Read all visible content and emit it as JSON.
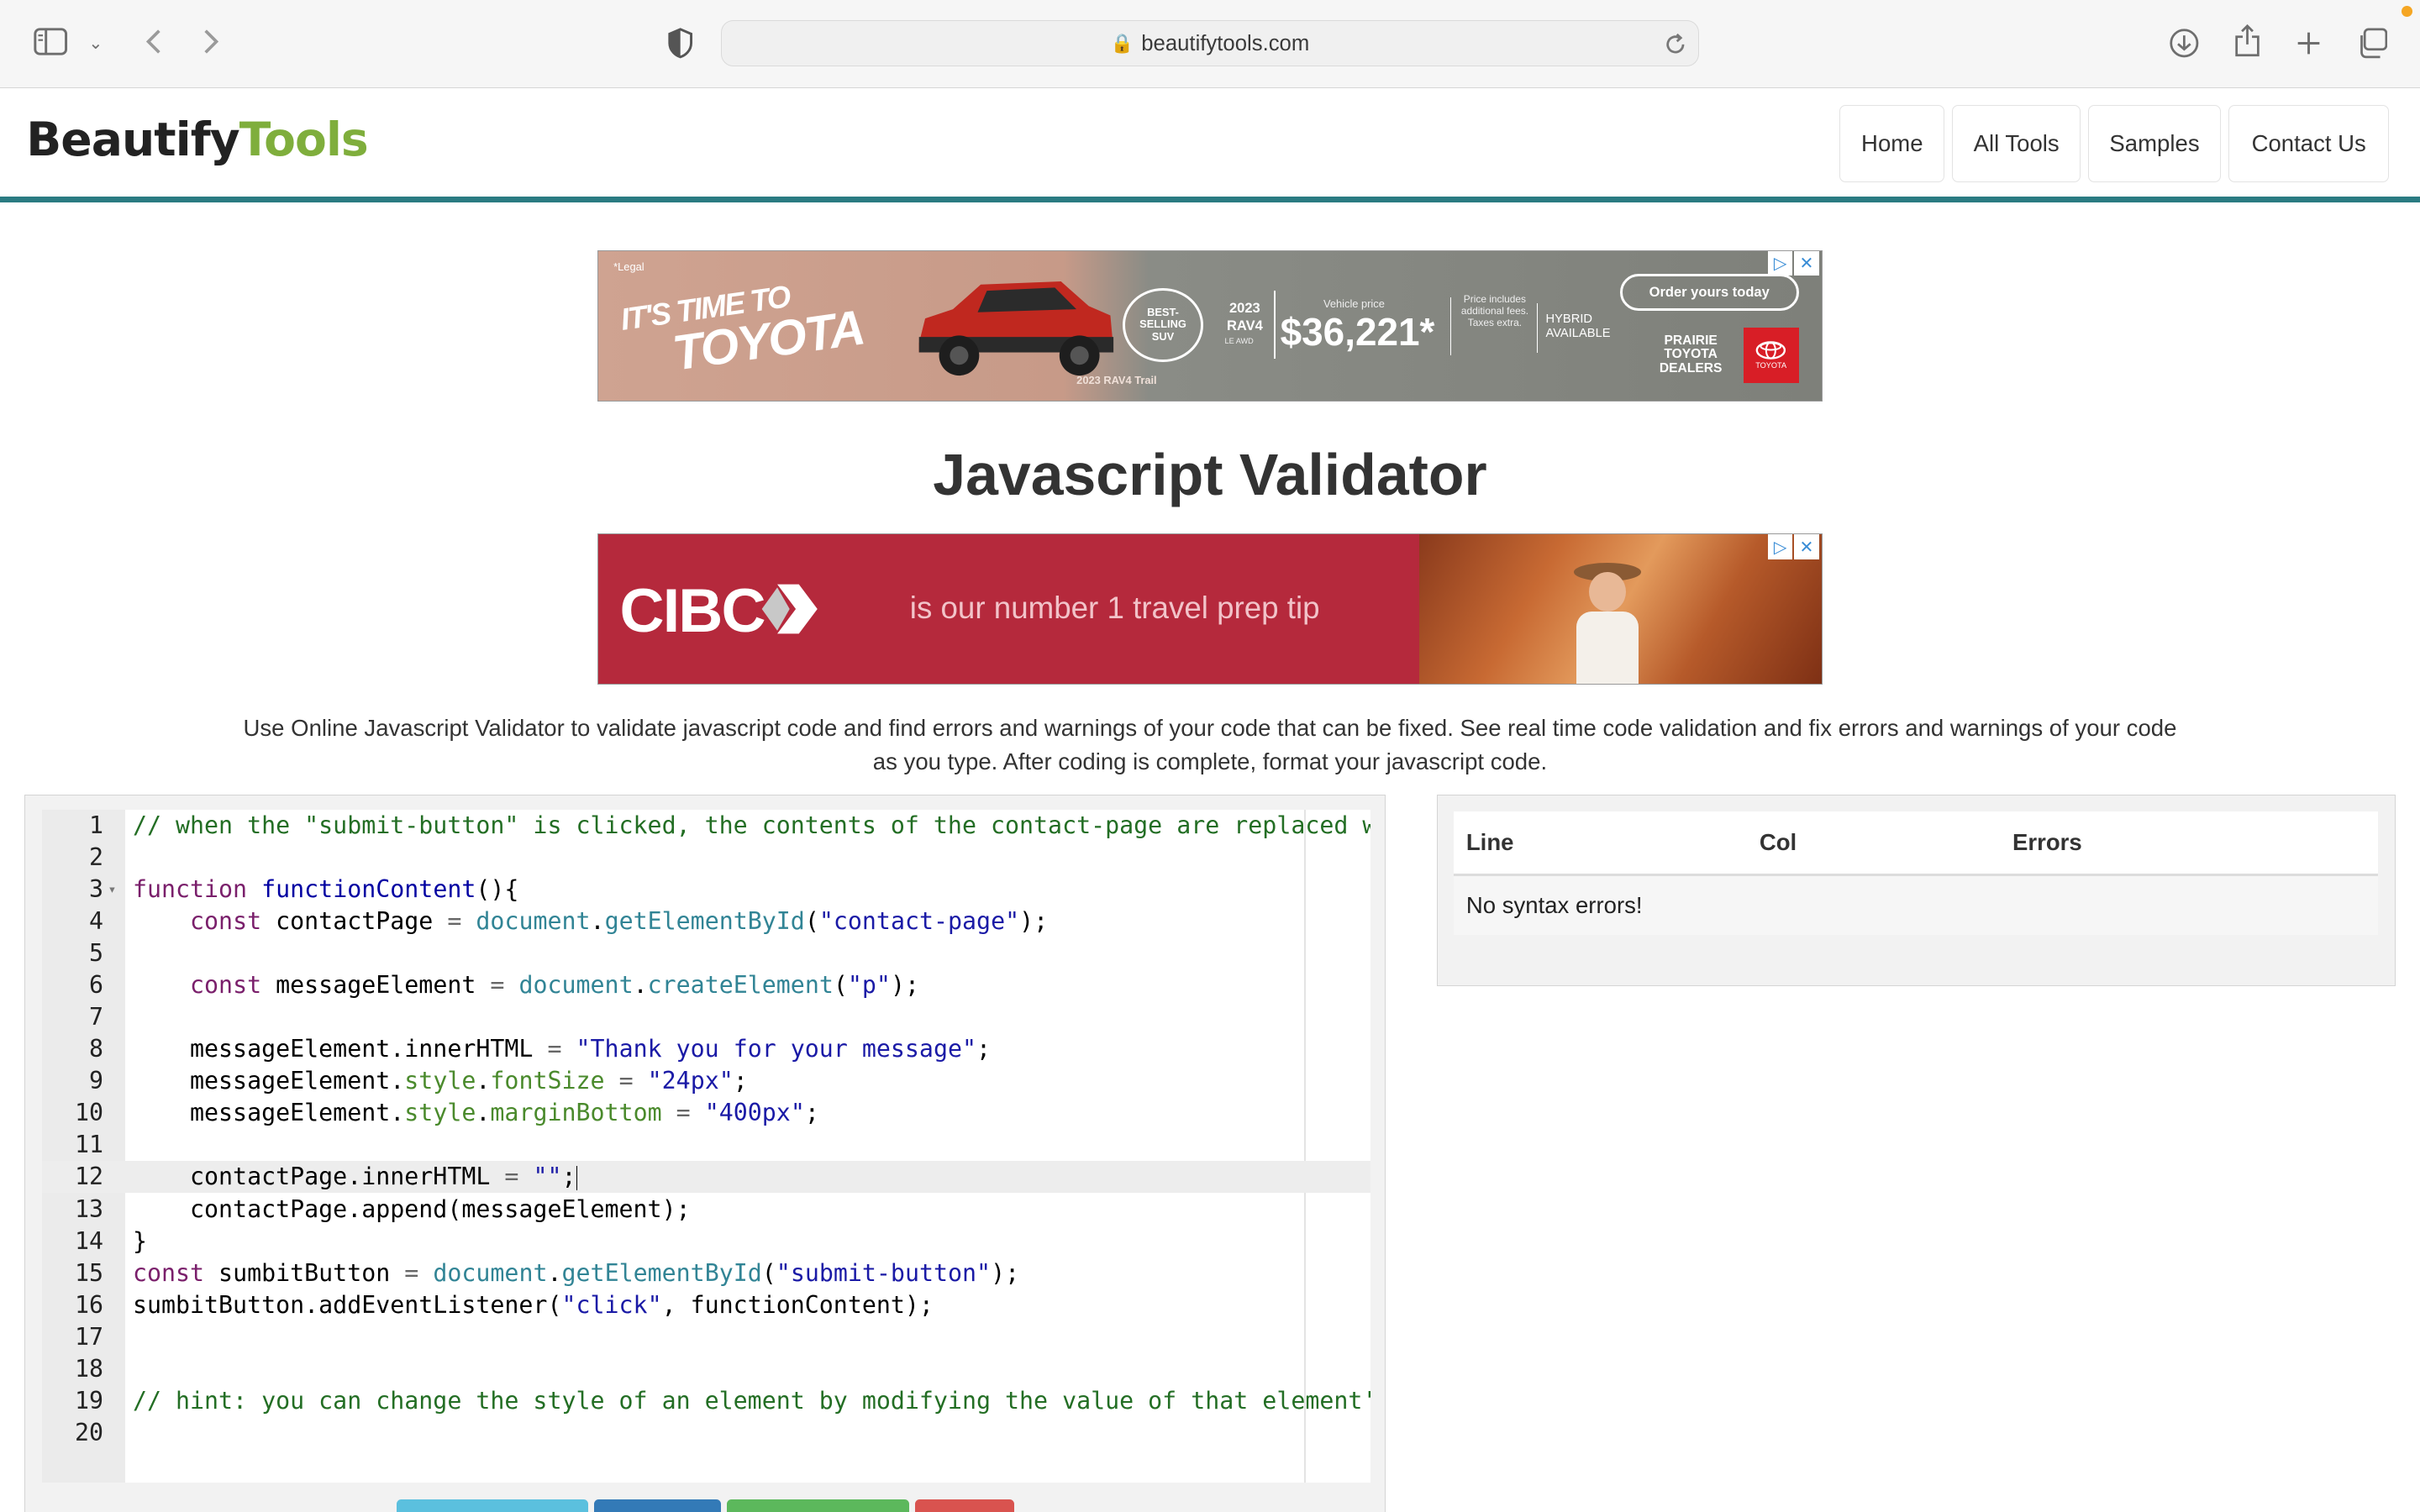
{
  "browser": {
    "url": "beautifytools.com"
  },
  "site": {
    "logo_part1": "Beautify",
    "logo_part2": "Tools",
    "nav": [
      "Home",
      "All Tools",
      "Samples",
      "Contact Us"
    ]
  },
  "ads": {
    "toyota": {
      "legal": "*Legal",
      "headline1": "IT'S TIME TO",
      "headline2": "TOYOTA",
      "model_caption": "2023 RAV4 Trail",
      "award": "BEST-SELLING SUV",
      "year_model": "2023 RAV4",
      "trim": "LE AWD",
      "vehicle_price_label": "Vehicle price",
      "price": "$36,221*",
      "price_note": "Price includes additional fees. Taxes extra.",
      "hybrid": "HYBRID AVAILABLE",
      "cta": "Order yours today",
      "dealer": "PRAIRIE TOYOTA DEALERS",
      "brand": "TOYOTA"
    },
    "cibc": {
      "brand": "CIBC",
      "tagline": "is our number 1 travel prep tip"
    }
  },
  "page": {
    "title": "Javascript Validator",
    "description": "Use Online Javascript Validator to validate javascript code and find errors and warnings of your code that can be fixed. See real time code validation and fix errors and warnings of your code as you type. After coding is complete, format your javascript code."
  },
  "editor": {
    "active_line": 12,
    "lines": [
      {
        "n": "1",
        "code": "// when the \"submit-button\" is clicked, the contents of the contact-page are replaced wi"
      },
      {
        "n": "2",
        "code": ""
      },
      {
        "n": "3",
        "code": "function functionContent(){"
      },
      {
        "n": "4",
        "code": "    const contactPage = document.getElementById(\"contact-page\");"
      },
      {
        "n": "5",
        "code": ""
      },
      {
        "n": "6",
        "code": "    const messageElement = document.createElement(\"p\");"
      },
      {
        "n": "7",
        "code": ""
      },
      {
        "n": "8",
        "code": "    messageElement.innerHTML = \"Thank you for your message\";"
      },
      {
        "n": "9",
        "code": "    messageElement.style.fontSize = \"24px\";"
      },
      {
        "n": "10",
        "code": "    messageElement.style.marginBottom = \"400px\";"
      },
      {
        "n": "11",
        "code": ""
      },
      {
        "n": "12",
        "code": "    contactPage.innerHTML = \"\";"
      },
      {
        "n": "13",
        "code": "    contactPage.append(messageElement);"
      },
      {
        "n": "14",
        "code": "}"
      },
      {
        "n": "15",
        "code": "const sumbitButton = document.getElementById(\"submit-button\");"
      },
      {
        "n": "16",
        "code": "sumbitButton.addEventListener(\"click\", functionContent);"
      },
      {
        "n": "17",
        "code": ""
      },
      {
        "n": "18",
        "code": ""
      },
      {
        "n": "19",
        "code": "// hint: you can change the style of an element by modifying the value of that element's"
      },
      {
        "n": "20",
        "code": ""
      }
    ]
  },
  "errors": {
    "headers": [
      "Line",
      "Col",
      "Errors"
    ],
    "message": "No syntax errors!"
  },
  "colors": {
    "accent": "#2a7b82",
    "logo_green": "#7fae3c",
    "cibc_red": "#b5293c"
  }
}
